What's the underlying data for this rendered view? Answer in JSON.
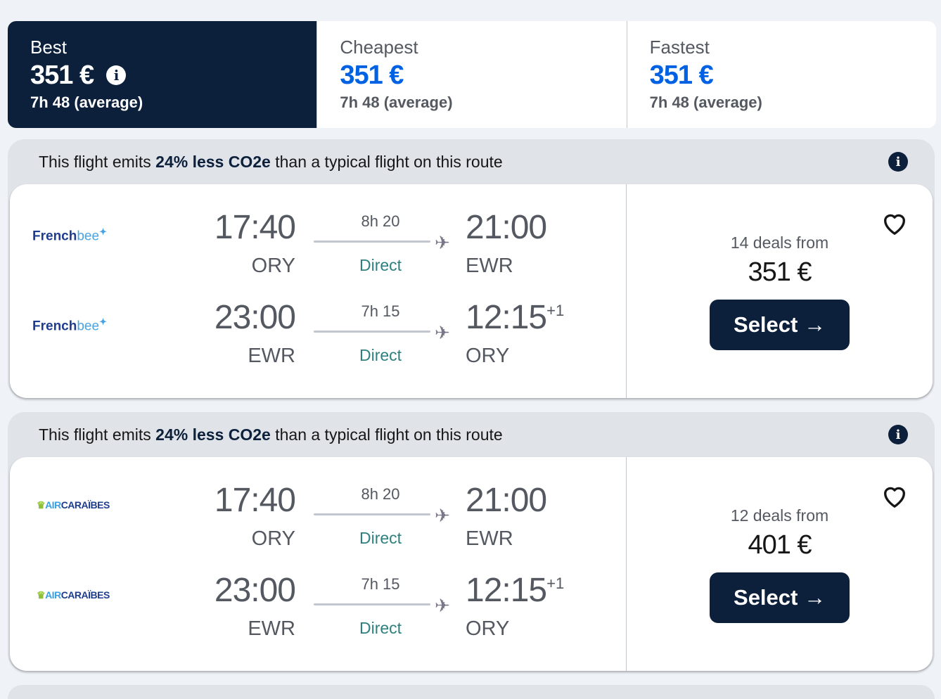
{
  "sort_tabs": [
    {
      "label": "Best",
      "price": "351 €",
      "duration": "7h 48 (average)",
      "active": true
    },
    {
      "label": "Cheapest",
      "price": "351 €",
      "duration": "7h 48 (average)",
      "active": false
    },
    {
      "label": "Fastest",
      "price": "351 €",
      "duration": "7h 48 (average)",
      "active": false
    }
  ],
  "info_icon": "info-icon",
  "results": [
    {
      "eco_prefix": "This flight emits ",
      "eco_bold": "24% less CO2e",
      "eco_suffix": " than a typical flight on this route",
      "airline": "Frenchbee",
      "legs": [
        {
          "dep_time": "17:40",
          "dep_code": "ORY",
          "duration": "8h 20",
          "stops": "Direct",
          "arr_time": "21:00",
          "arr_day_offset": "",
          "arr_code": "EWR"
        },
        {
          "dep_time": "23:00",
          "dep_code": "EWR",
          "duration": "7h 15",
          "stops": "Direct",
          "arr_time": "12:15",
          "arr_day_offset": "+1",
          "arr_code": "ORY"
        }
      ],
      "deals": "14 deals from",
      "price": "351 €",
      "select_label": "Select →"
    },
    {
      "eco_prefix": "This flight emits ",
      "eco_bold": "24% less CO2e",
      "eco_suffix": " than a typical flight on this route",
      "airline": "Air Caraïbes",
      "legs": [
        {
          "dep_time": "17:40",
          "dep_code": "ORY",
          "duration": "8h 20",
          "stops": "Direct",
          "arr_time": "21:00",
          "arr_day_offset": "",
          "arr_code": "EWR"
        },
        {
          "dep_time": "23:00",
          "dep_code": "EWR",
          "duration": "7h 15",
          "stops": "Direct",
          "arr_time": "12:15",
          "arr_day_offset": "+1",
          "arr_code": "ORY"
        }
      ],
      "deals": "12 deals from",
      "price": "401 €",
      "select_label": "Select →"
    }
  ],
  "logos": {
    "frenchbee": {
      "a": "French",
      "b": "bee",
      "c": "✦"
    },
    "aircaraibes": {
      "a": "♛",
      "b": "AIR",
      "c": "CARAÏBES"
    }
  },
  "colors": {
    "navy": "#0c1f3b",
    "accent_blue": "#0062e3",
    "direct_teal": "#2e8080"
  }
}
